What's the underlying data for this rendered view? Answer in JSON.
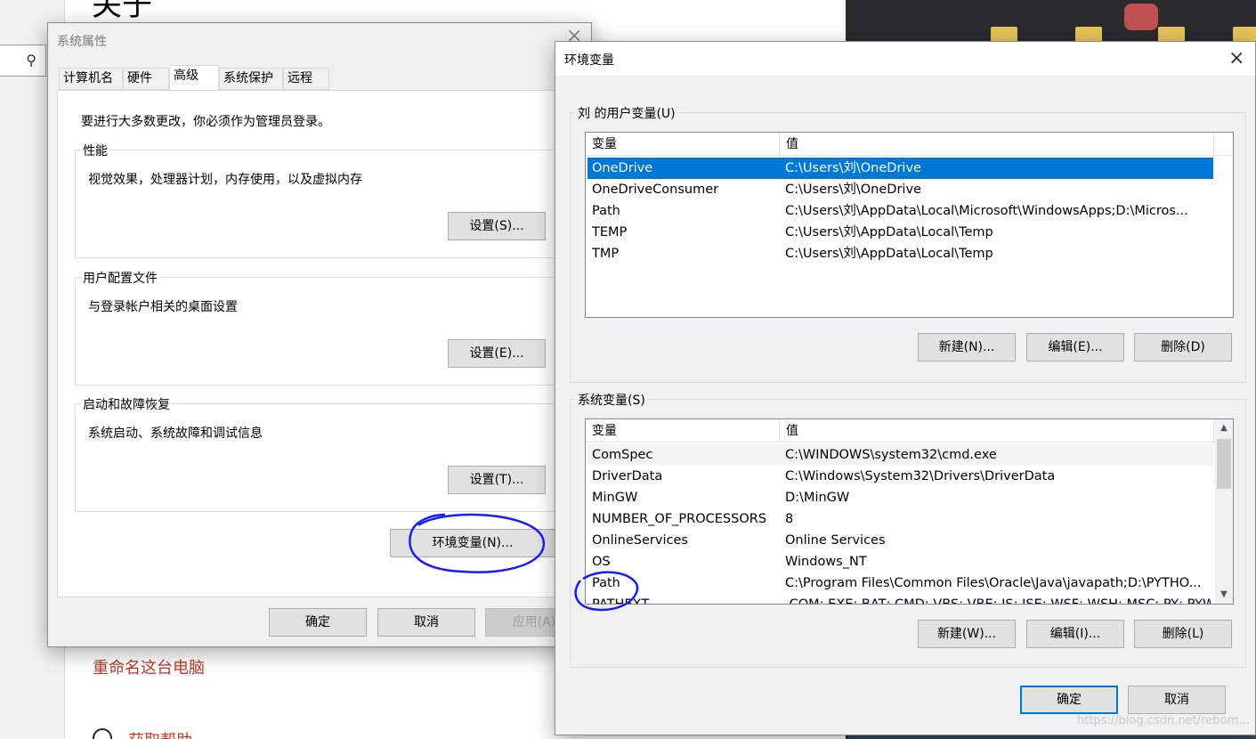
{
  "background": {
    "title": "关于",
    "rename_link": "重命名这台电脑",
    "help_link": "获取帮助",
    "search_icon": "search-icon"
  },
  "sysprops": {
    "title": "系统属性",
    "tabs": [
      "计算机名",
      "硬件",
      "高级",
      "系统保护",
      "远程"
    ],
    "active_tab": "高级",
    "admin_note": "要进行大多数更改，你必须作为管理员登录。",
    "performance": {
      "label": "性能",
      "desc": "视觉效果，处理器计划，内存使用，以及虚拟内存",
      "button": "设置(S)..."
    },
    "profile": {
      "label": "用户配置文件",
      "desc": "与登录帐户相关的桌面设置",
      "button": "设置(E)..."
    },
    "startup": {
      "label": "启动和故障恢复",
      "desc": "系统启动、系统故障和调试信息",
      "button": "设置(T)..."
    },
    "env_button": "环境变量(N)...",
    "ok": "确定",
    "cancel": "取消",
    "apply": "应用(A)"
  },
  "envvars": {
    "title": "环境变量",
    "user_group": "刘 的用户变量(U)",
    "system_group": "系统变量(S)",
    "col_name": "变量",
    "col_value": "值",
    "user_vars": [
      {
        "name": "OneDrive",
        "value": "C:\\Users\\刘\\OneDrive"
      },
      {
        "name": "OneDriveConsumer",
        "value": "C:\\Users\\刘\\OneDrive"
      },
      {
        "name": "Path",
        "value": "C:\\Users\\刘\\AppData\\Local\\Microsoft\\WindowsApps;D:\\Micros..."
      },
      {
        "name": "TEMP",
        "value": "C:\\Users\\刘\\AppData\\Local\\Temp"
      },
      {
        "name": "TMP",
        "value": "C:\\Users\\刘\\AppData\\Local\\Temp"
      }
    ],
    "user_buttons": {
      "new": "新建(N)...",
      "edit": "编辑(E)...",
      "delete": "删除(D)"
    },
    "system_vars": [
      {
        "name": "ComSpec",
        "value": "C:\\WINDOWS\\system32\\cmd.exe"
      },
      {
        "name": "DriverData",
        "value": "C:\\Windows\\System32\\Drivers\\DriverData"
      },
      {
        "name": "MinGW",
        "value": "D:\\MinGW"
      },
      {
        "name": "NUMBER_OF_PROCESSORS",
        "value": "8"
      },
      {
        "name": "OnlineServices",
        "value": "Online Services"
      },
      {
        "name": "OS",
        "value": "Windows_NT"
      },
      {
        "name": "Path",
        "value": "C:\\Program Files\\Common Files\\Oracle\\Java\\javapath;D:\\PYTHO..."
      },
      {
        "name": "PATHEXT",
        "value": ".COM;.EXE;.BAT;.CMD;.VBS;.VBE;.JS;.JSE;.WSF;.WSH;.MSC;.PY;.PYW"
      }
    ],
    "system_buttons": {
      "new": "新建(W)...",
      "edit": "编辑(I)...",
      "delete": "删除(L)"
    },
    "ok": "确定",
    "cancel": "取消"
  },
  "watermark": "https://blog.csdn.net/reborn...",
  "colors": {
    "selection": "#0078d7",
    "annotation": "#1a1aff",
    "link": "#c0392b"
  }
}
